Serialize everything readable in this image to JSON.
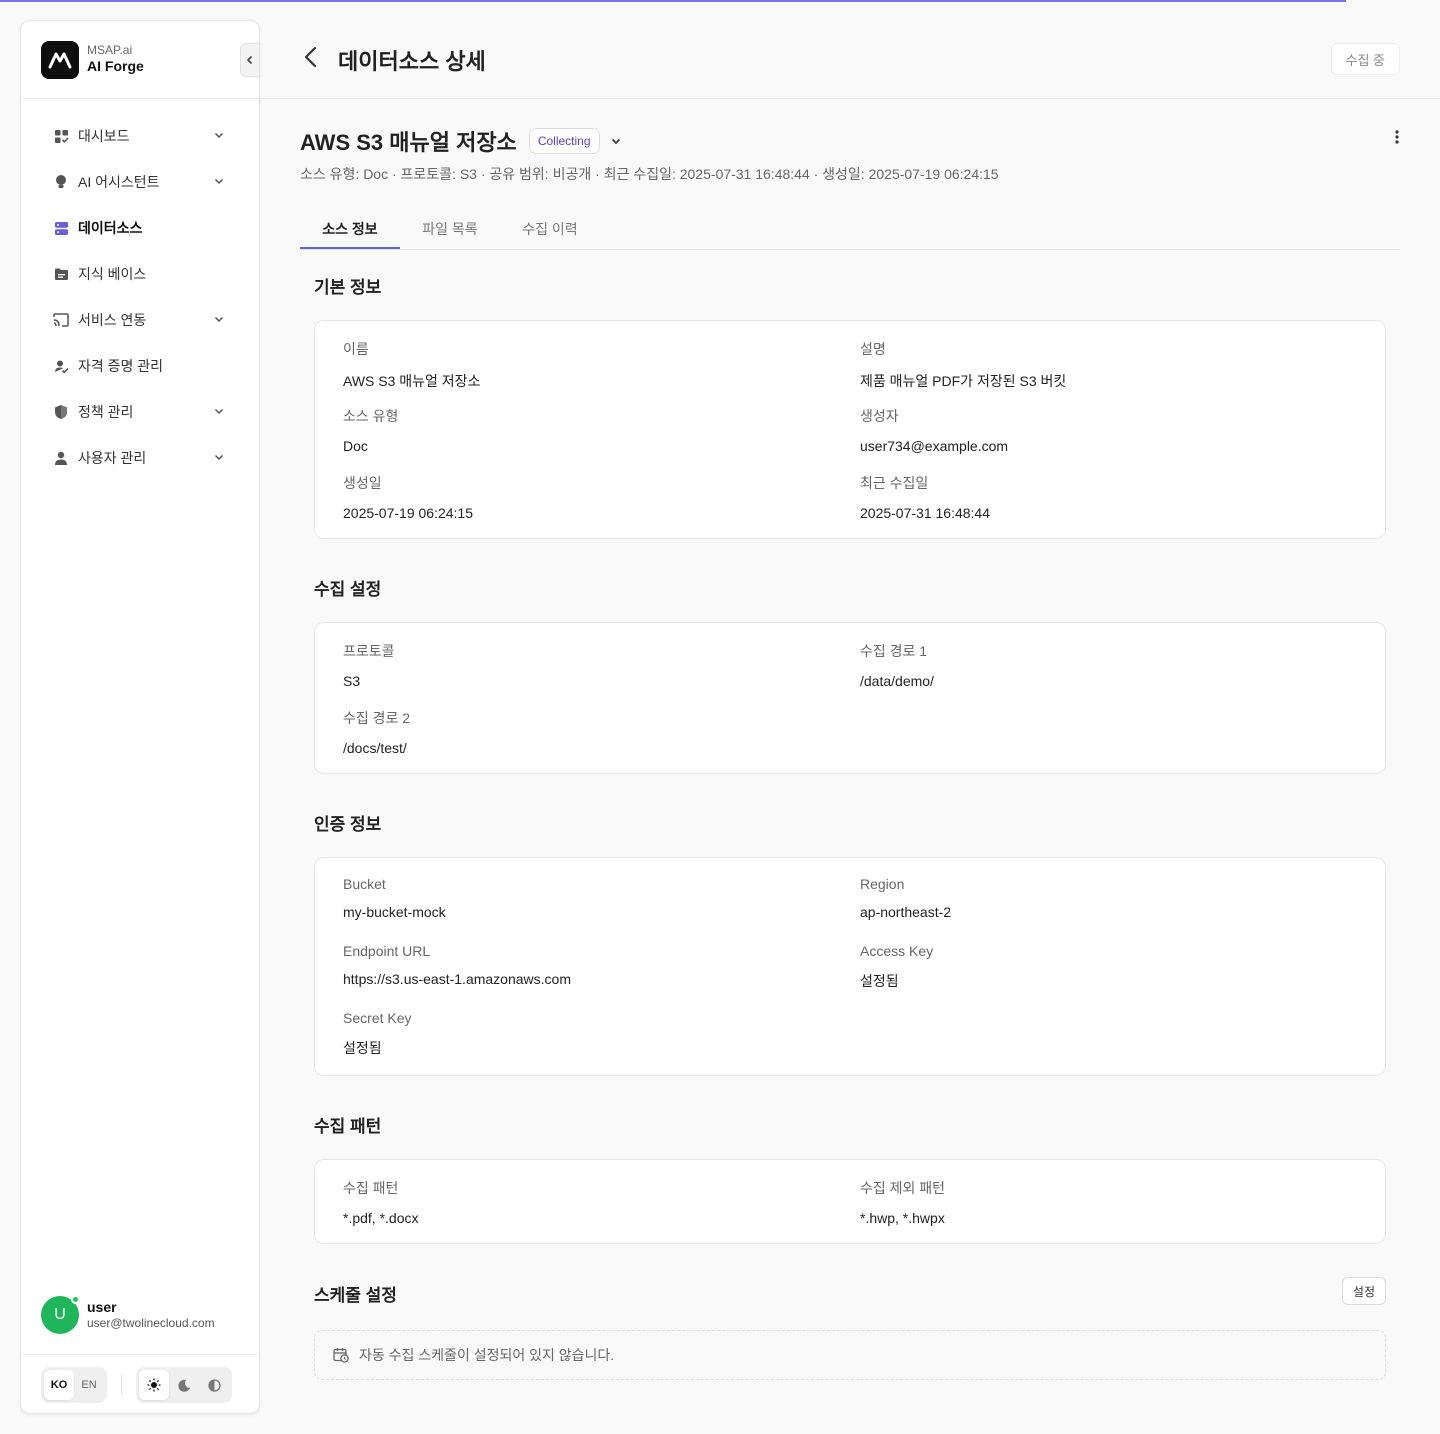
{
  "app": {
    "brand_sub": "MSAP.ai",
    "brand_name": "AI Forge",
    "accent_color": "#6a5fd9"
  },
  "sidebar": {
    "items": [
      {
        "label": "대시보드",
        "icon": "dashboard-icon",
        "expandable": true
      },
      {
        "label": "AI 어시스턴트",
        "icon": "lightbulb-icon",
        "expandable": true
      },
      {
        "label": "데이터소스",
        "icon": "datasource-icon",
        "expandable": false,
        "active": true
      },
      {
        "label": "지식 베이스",
        "icon": "folder-icon",
        "expandable": false
      },
      {
        "label": "서비스 연동",
        "icon": "cast-icon",
        "expandable": true
      },
      {
        "label": "자격 증명 관리",
        "icon": "credential-icon",
        "expandable": false
      },
      {
        "label": "정책 관리",
        "icon": "shield-icon",
        "expandable": true
      },
      {
        "label": "사용자 관리",
        "icon": "person-icon",
        "expandable": true
      }
    ],
    "user": {
      "initial": "U",
      "name": "user",
      "email": "user@twolinecloud.com"
    },
    "lang": {
      "ko": "KO",
      "en": "EN",
      "selected": "KO"
    },
    "theme_selected": "light"
  },
  "header": {
    "title": "데이터소스 상세",
    "status": "수집 중"
  },
  "datasource": {
    "title": "AWS S3 매뉴얼 저장소",
    "badge": "Collecting",
    "meta": "소스 유형: Doc · 프로토콜: S3 · 공유 범위: 비공개 · 최근 수집일: 2025-07-31 16:48:44 · 생성일: 2025-07-19 06:24:15"
  },
  "tabs": [
    "소스 정보",
    "파일 목록",
    "수집 이력"
  ],
  "sections": {
    "basic": {
      "title": "기본 정보",
      "fields": [
        {
          "label": "이름",
          "value": "AWS S3 매뉴얼 저장소"
        },
        {
          "label": "설명",
          "value": "제품 매뉴얼 PDF가 저장된 S3 버킷"
        },
        {
          "label": "소스 유형",
          "value": "Doc"
        },
        {
          "label": "생성자",
          "value": "user734@example.com"
        },
        {
          "label": "생성일",
          "value": "2025-07-19 06:24:15"
        },
        {
          "label": "최근 수집일",
          "value": "2025-07-31 16:48:44"
        }
      ]
    },
    "collect": {
      "title": "수집 설정",
      "fields": [
        {
          "label": "프로토콜",
          "value": "S3"
        },
        {
          "label": "수집 경로 1",
          "value": "/data/demo/"
        },
        {
          "label": "수집 경로 2",
          "value": "/docs/test/"
        }
      ]
    },
    "auth": {
      "title": "인증 정보",
      "fields": [
        {
          "label": "Bucket",
          "value": "my-bucket-mock"
        },
        {
          "label": "Region",
          "value": "ap-northeast-2"
        },
        {
          "label": "Endpoint URL",
          "value": "https://s3.us-east-1.amazonaws.com"
        },
        {
          "label": "Access Key",
          "value": "설정됨"
        },
        {
          "label": "Secret Key",
          "value": "설정됨"
        }
      ]
    },
    "pattern": {
      "title": "수집 패턴",
      "fields": [
        {
          "label": "수집 패턴",
          "value": "*.pdf, *.docx"
        },
        {
          "label": "수집 제외 패턴",
          "value": "*.hwp, *.hwpx"
        }
      ]
    },
    "schedule": {
      "title": "스케줄 설정",
      "button": "설정",
      "empty": "자동 수집 스케줄이 설정되어 있지 않습니다."
    }
  }
}
